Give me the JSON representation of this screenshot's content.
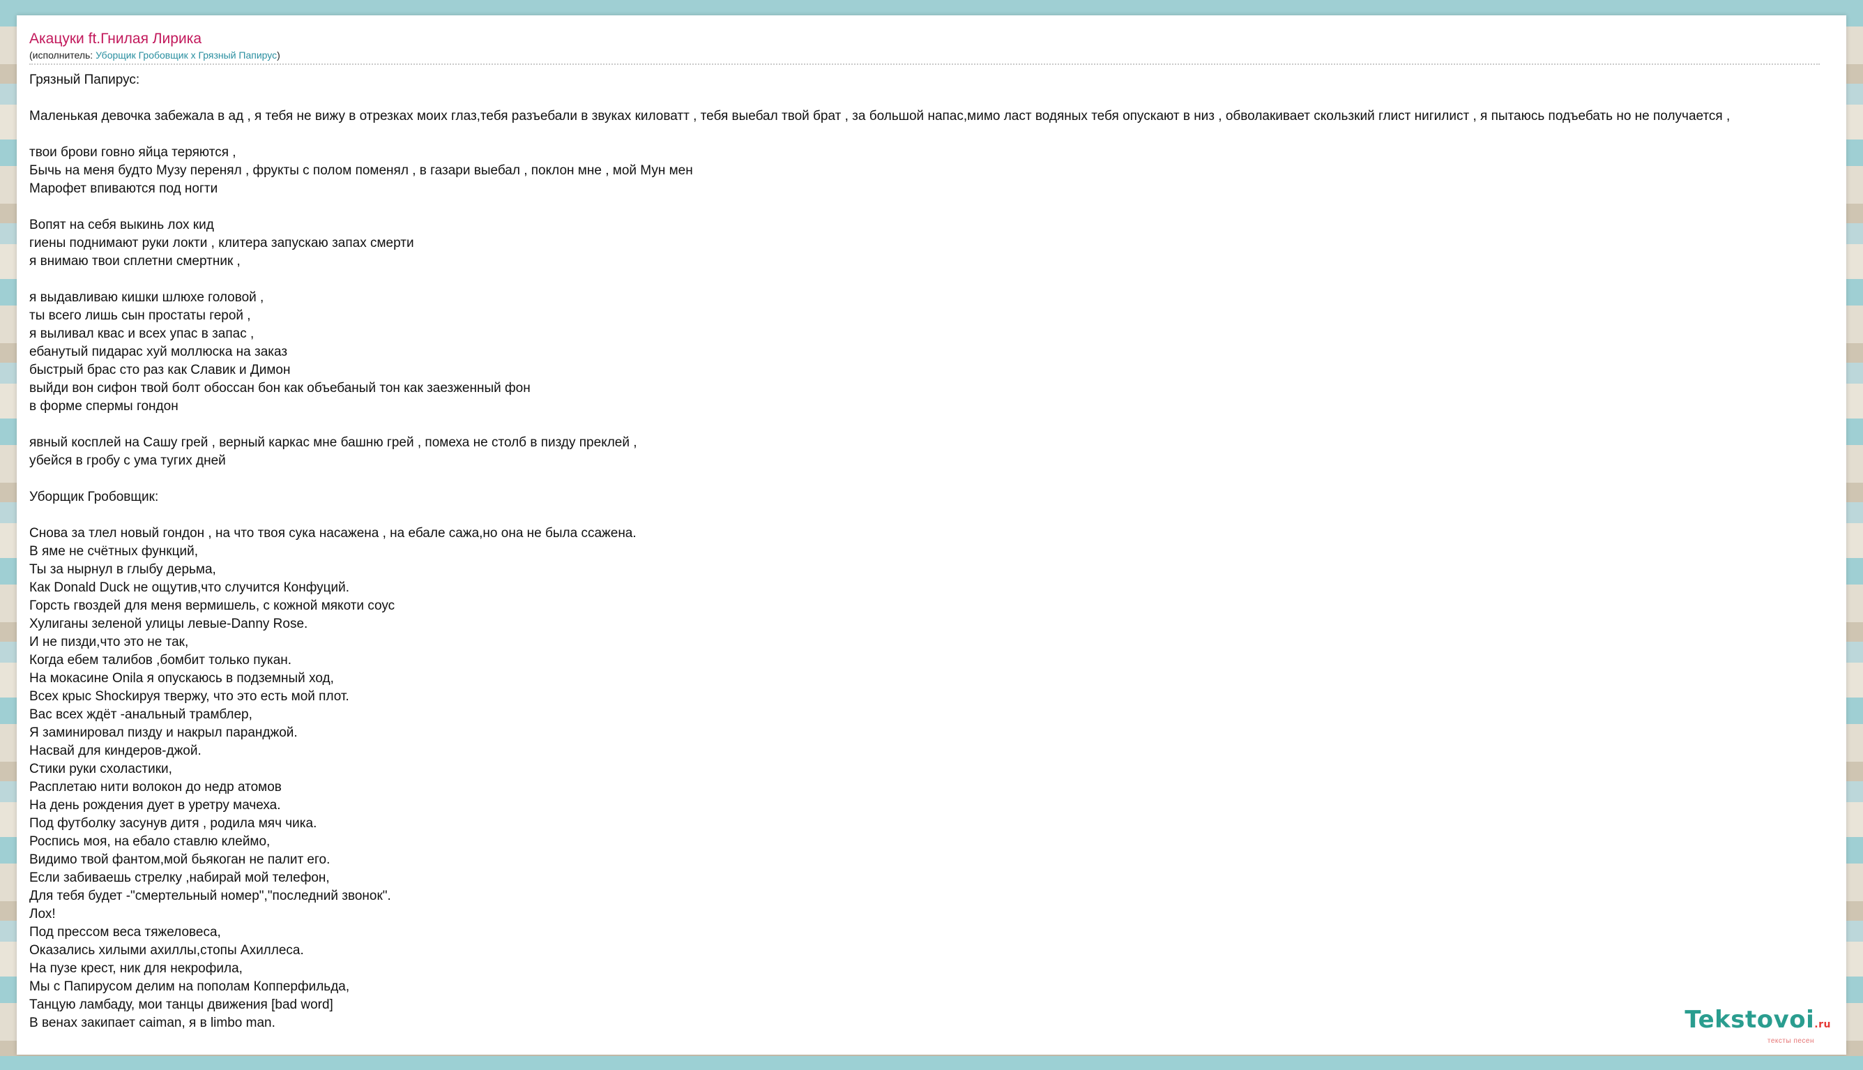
{
  "header": {
    "song_title": "Акацуки ft.Гнилая Лирика",
    "performer_prefix": "(исполнитель: ",
    "performer_link": "Уборщик Гробовщик x Грязный Папирус",
    "performer_suffix": ")"
  },
  "lyrics": [
    "Грязный Папирус:",
    "",
    "Маленькая девочка забежала в ад , я тебя не вижу в отрезках моих глаз,тебя разъебали в звуках киловатт , тебя выебал твой брат , за большой напас,мимо ласт водяных тебя опускают в низ , обволакивает скользкий глист нигилист , я пытаюсь подъебать но не получается ,",
    "",
    "твои брови говно яйца теряются ,",
    "Бычь на меня будто Музу перенял , фрукты с полом поменял , в газари выебал , поклон мне , мой Мун мен",
    "Марофет впиваются под ногти",
    "",
    "Вопят на себя выкинь лох кид",
    "гиены поднимают руки локти , клитера запускаю запах смерти",
    "я внимаю твои сплетни смертник ,",
    "",
    "я выдавливаю кишки шлюхе головой ,",
    "ты всего лишь сын простаты герой ,",
    "я выливал квас и всех упас в запас ,",
    "ебанутый пидарас хуй моллюска на заказ",
    "быстрый брас сто раз как Славик и Димон",
    "выйди вон сифон твой болт обоссан бон как объебаный тон как заезженный фон",
    "в форме спермы гондон",
    "",
    "явный косплей на Сашу грей , верный каркас мне башню грей , помеха не столб в пизду преклей ,",
    "убейся в гробу с ума тугих дней",
    "",
    "Уборщик Гробовщик:",
    "",
    "Снова за тлел новый гондон , на что твоя сука насажена , на ебале сажа,но она не была ссажена.",
    "В яме не счётных функций,",
    "Ты за нырнул в глыбу дерьма,",
    "Как Donald Duck не ощутив,что случится Конфуций.",
    "Горсть гвоздей для меня вермишель, с кожной мякоти соус",
    "Хулиганы зеленой улицы левые-Danny Rose.",
    "И не пизди,что это не так,",
    "Когда ебем талибов ,бомбит только пукан.",
    "На мокасине Onila я опускаюсь в подземный ход,",
    "Всех крыс Shockируя твержу, что это есть мой плот.",
    "Вас всех ждёт -анальный трамблер,",
    "Я заминировал пизду и накрыл паранджой.",
    "Насвай для киндеров-джой.",
    "Стики руки схоластики,",
    "Расплетаю нити волокон до недр атомов",
    "На день рождения дует в уретру мачеха.",
    "Под футболку засунув дитя , родила мяч чика.",
    "Роспись моя, на ебало ставлю клеймо,",
    "Видимо твой фантом,мой бьякоган не палит его.",
    "Если забиваешь стрелку ,набирай мой телефон,",
    "Для тебя будет -\"смертельный номер\",\"последний звонок\".",
    "Лох!",
    "Под прессом веса тяжеловеса,",
    "Оказались хилыми ахиллы,стопы Ахиллеса.",
    "На пузе крест, ник для некрофила,",
    "Мы с Папирусом делим на пополам Копперфильда,",
    "Танцую ламбаду, мои танцы движения [bad word]",
    "В венах закипает caiman, я в limbo man."
  ],
  "logo": {
    "name": "Tekstovoi",
    "tld": ".ru",
    "tagline": "тексты песен"
  }
}
